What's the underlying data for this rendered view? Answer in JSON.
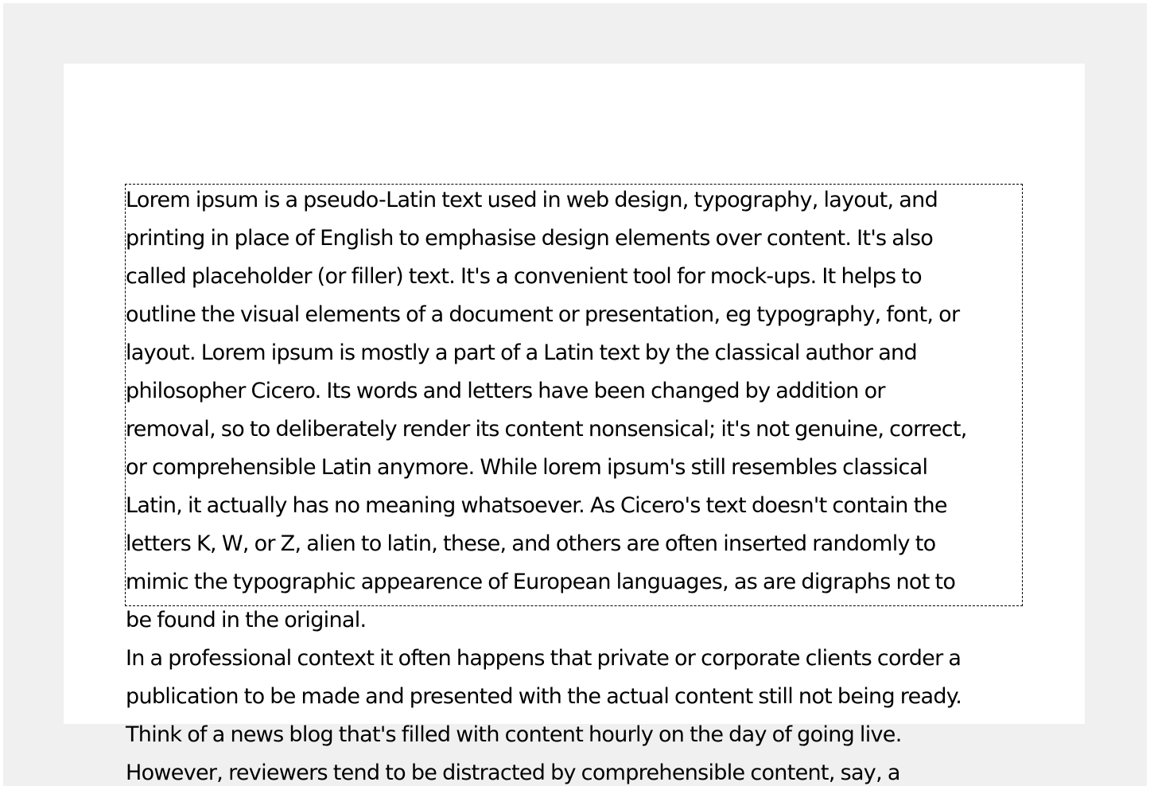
{
  "document": {
    "paragraph_1_lines": [
      "Lorem ipsum is a pseudo-Latin text used in web design, typography, layout, and",
      "printing in place of English to emphasise design elements over content. It's also",
      "called placeholder (or filler) text. It's a convenient tool for mock-ups. It helps to",
      "outline the visual elements of a document or presentation, eg typography, font, or",
      "layout. Lorem ipsum is mostly a part of a Latin text by the classical author and",
      "philosopher Cicero. Its words and letters have been changed by addition or",
      "removal, so to deliberately render its content nonsensical; it's not genuine, correct,",
      "or comprehensible Latin anymore. While lorem ipsum's still resembles classical",
      "Latin, it actually has no meaning whatsoever. As Cicero's text doesn't contain the",
      "letters K, W, or Z, alien to latin, these, and others are often inserted randomly to",
      "mimic the typographic appearence of European languages, as are digraphs not to",
      "be found in the original."
    ],
    "paragraph_2_lines": [
      "In a professional context it often happens that private or corporate clients corder a",
      "publication to be made and presented with the actual content still not being ready.",
      "Think of a news blog that's filled with content hourly on the day of going live.",
      "However, reviewers tend to be distracted by comprehensible content, say, a"
    ]
  },
  "colors": {
    "viewport_background": "#f0f0f0",
    "page_background": "#ffffff",
    "text": "#000000",
    "selection_border": "#000000"
  }
}
